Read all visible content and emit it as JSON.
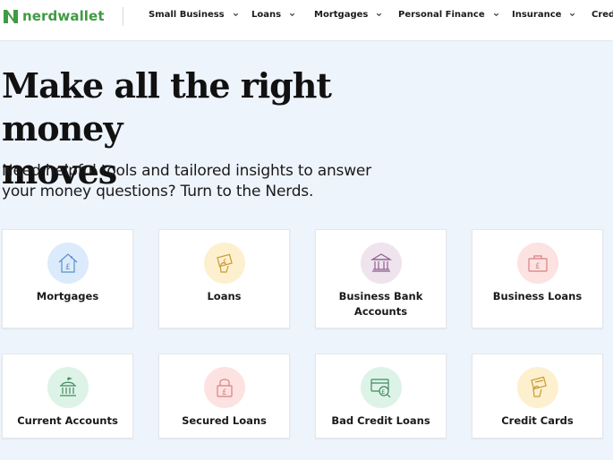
{
  "brand": {
    "name": "nerdwallet",
    "color": "#3f9b44"
  },
  "nav": {
    "items": [
      {
        "label": "Small Business",
        "has_dropdown": true
      },
      {
        "label": "Loans",
        "has_dropdown": true
      },
      {
        "label": "Mortgages",
        "has_dropdown": true
      },
      {
        "label": "Personal Finance",
        "has_dropdown": true
      },
      {
        "label": "Insurance",
        "has_dropdown": true
      },
      {
        "label": "Cred",
        "has_dropdown": false
      }
    ]
  },
  "hero": {
    "title_line1": "Make all the right money",
    "title_line2": "moves",
    "subtitle_line1": "Need helpful tools and tailored insights to answer",
    "subtitle_line2": "your money questions? Turn to the Nerds."
  },
  "cards": [
    {
      "label": "Mortgages",
      "icon": "house-pound-icon",
      "bg": "#dcebfb",
      "stroke": "#5b8fc7"
    },
    {
      "label": "Loans",
      "icon": "hand-pound-icon",
      "bg": "#fdf0cf",
      "stroke": "#c89a33"
    },
    {
      "label_line1": "Business Bank",
      "label_line2": "Accounts",
      "icon": "bank-building-icon",
      "bg": "#efe4ee",
      "stroke": "#8f5f8f"
    },
    {
      "label": "Business Loans",
      "icon": "briefcase-pound-icon",
      "bg": "#fde2e2",
      "stroke": "#d9807f"
    },
    {
      "label": "Current Accounts",
      "icon": "bank-dome-icon",
      "bg": "#def3e7",
      "stroke": "#3f8a5e"
    },
    {
      "label": "Secured Loans",
      "icon": "padlock-pound-icon",
      "bg": "#fde2e2",
      "stroke": "#d9807f"
    },
    {
      "label": "Bad Credit Loans",
      "icon": "credit-card-pound-icon",
      "bg": "#def3e7",
      "stroke": "#3f8a5e"
    },
    {
      "label": "Credit Cards",
      "icon": "hand-card-icon",
      "bg": "#fdf0cf",
      "stroke": "#c89a33"
    }
  ]
}
